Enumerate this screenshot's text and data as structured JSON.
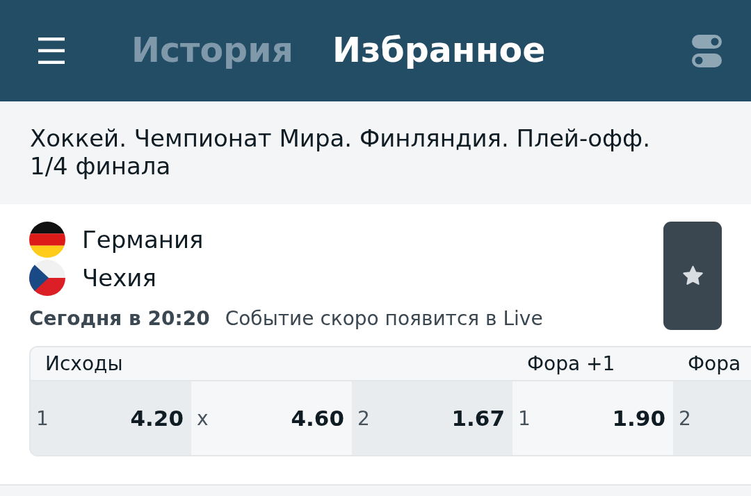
{
  "header": {
    "tabs": [
      {
        "label": "История",
        "selected": false
      },
      {
        "label": "Избранное",
        "selected": true
      }
    ]
  },
  "league": {
    "title": "Хоккей. Чемпионат Мира. Финляндия. Плей-офф. 1/4 финала"
  },
  "event": {
    "teams": [
      {
        "name": "Германия"
      },
      {
        "name": "Чехия"
      }
    ],
    "start_time": "Сегодня в 20:20",
    "status": "Событие скоро появится в Live",
    "favorite": true
  },
  "markets": [
    {
      "title": "Исходы",
      "outcomes": [
        {
          "label": "1",
          "odds": "4.20"
        },
        {
          "label": "x",
          "odds": "4.60"
        },
        {
          "label": "2",
          "odds": "1.67"
        }
      ]
    },
    {
      "title": "Фора +1",
      "outcomes": [
        {
          "label": "1",
          "odds": "1.90"
        }
      ]
    },
    {
      "title": "Фора",
      "outcomes": [
        {
          "label": "2"
        }
      ]
    }
  ]
}
